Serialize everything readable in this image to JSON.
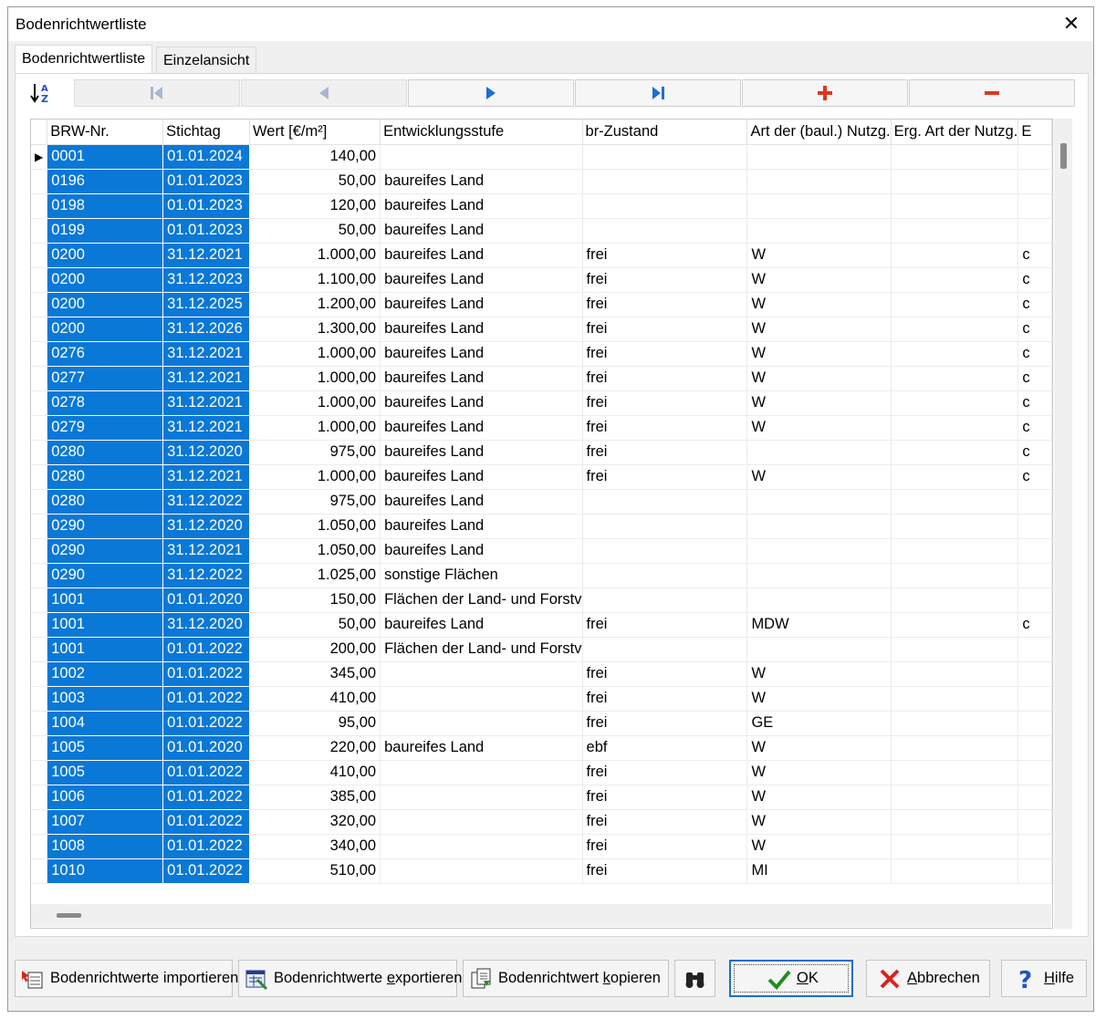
{
  "window": {
    "title": "Bodenrichtwertliste",
    "close_glyph": "✕"
  },
  "tabs": [
    {
      "label": "Bodenrichtwertliste",
      "active": true
    },
    {
      "label": "Einzelansicht",
      "active": false
    }
  ],
  "navigator": {
    "buttons": [
      "first-icon",
      "prior-icon",
      "next-icon",
      "last-icon",
      "plus-icon",
      "minus-icon"
    ],
    "colors": {
      "disabled": "#a9b7cc",
      "active": "#1f6ed4",
      "add": "#e0361c",
      "remove": "#e0361c"
    }
  },
  "grid": {
    "columns": [
      "BRW-Nr.",
      "Stichtag",
      "Wert [€/m²]",
      "Entwicklungsstufe",
      "br-Zustand",
      "Art der (baul.) Nutzg.",
      "Erg. Art der Nutzg.",
      "E"
    ],
    "current_row_marker": "▶",
    "selection_color": "#0a78d7",
    "rows": [
      [
        "0001",
        "01.01.2024",
        "140,00",
        "",
        "",
        "",
        "",
        ""
      ],
      [
        "0196",
        "01.01.2023",
        "50,00",
        "baureifes Land",
        "",
        "",
        "",
        ""
      ],
      [
        "0198",
        "01.01.2023",
        "120,00",
        "baureifes Land",
        "",
        "",
        "",
        ""
      ],
      [
        "0199",
        "01.01.2023",
        "50,00",
        "baureifes Land",
        "",
        "",
        "",
        ""
      ],
      [
        "0200",
        "31.12.2021",
        "1.000,00",
        "baureifes Land",
        "frei",
        "W",
        "",
        "c"
      ],
      [
        "0200",
        "31.12.2023",
        "1.100,00",
        "baureifes Land",
        "frei",
        "W",
        "",
        "c"
      ],
      [
        "0200",
        "31.12.2025",
        "1.200,00",
        "baureifes Land",
        "frei",
        "W",
        "",
        "c"
      ],
      [
        "0200",
        "31.12.2026",
        "1.300,00",
        "baureifes Land",
        "frei",
        "W",
        "",
        "c"
      ],
      [
        "0276",
        "31.12.2021",
        "1.000,00",
        "baureifes Land",
        "frei",
        "W",
        "",
        "c"
      ],
      [
        "0277",
        "31.12.2021",
        "1.000,00",
        "baureifes Land",
        "frei",
        "W",
        "",
        "c"
      ],
      [
        "0278",
        "31.12.2021",
        "1.000,00",
        "baureifes Land",
        "frei",
        "W",
        "",
        "c"
      ],
      [
        "0279",
        "31.12.2021",
        "1.000,00",
        "baureifes Land",
        "frei",
        "W",
        "",
        "c"
      ],
      [
        "0280",
        "31.12.2020",
        "975,00",
        "baureifes Land",
        "frei",
        "",
        "",
        "c"
      ],
      [
        "0280",
        "31.12.2021",
        "1.000,00",
        "baureifes Land",
        "frei",
        "W",
        "",
        "c"
      ],
      [
        "0280",
        "31.12.2022",
        "975,00",
        "baureifes Land",
        "",
        "",
        "",
        ""
      ],
      [
        "0290",
        "31.12.2020",
        "1.050,00",
        "baureifes Land",
        "",
        "",
        "",
        ""
      ],
      [
        "0290",
        "31.12.2021",
        "1.050,00",
        "baureifes Land",
        "",
        "",
        "",
        ""
      ],
      [
        "0290",
        "31.12.2022",
        "1.025,00",
        "sonstige Flächen",
        "",
        "",
        "",
        ""
      ],
      [
        "1001",
        "01.01.2020",
        "150,00",
        "Flächen der Land- und Forstv",
        "",
        "",
        "",
        ""
      ],
      [
        "1001",
        "31.12.2020",
        "50,00",
        "baureifes Land",
        "frei",
        "MDW",
        "",
        "c"
      ],
      [
        "1001",
        "01.01.2022",
        "200,00",
        "Flächen der Land- und Forstv",
        "",
        "",
        "",
        ""
      ],
      [
        "1002",
        "01.01.2022",
        "345,00",
        "",
        "frei",
        "W",
        "",
        ""
      ],
      [
        "1003",
        "01.01.2022",
        "410,00",
        "",
        "frei",
        "W",
        "",
        ""
      ],
      [
        "1004",
        "01.01.2022",
        "95,00",
        "",
        "frei",
        "GE",
        "",
        ""
      ],
      [
        "1005",
        "01.01.2020",
        "220,00",
        "baureifes Land",
        "ebf",
        "W",
        "",
        ""
      ],
      [
        "1005",
        "01.01.2022",
        "410,00",
        "",
        "frei",
        "W",
        "",
        ""
      ],
      [
        "1006",
        "01.01.2022",
        "385,00",
        "",
        "frei",
        "W",
        "",
        ""
      ],
      [
        "1007",
        "01.01.2022",
        "320,00",
        "",
        "frei",
        "W",
        "",
        ""
      ],
      [
        "1008",
        "01.01.2022",
        "340,00",
        "",
        "frei",
        "W",
        "",
        ""
      ],
      [
        "1010",
        "01.01.2022",
        "510,00",
        "",
        "frei",
        "MI",
        "",
        ""
      ]
    ]
  },
  "buttons": {
    "import": {
      "label": "Bodenrichtwerte importieren",
      "icon": "import-icon"
    },
    "export": {
      "pre": "Bodenrichtwerte ",
      "ul": "e",
      "post": "xportieren",
      "icon": "export-icon"
    },
    "copy": {
      "pre": "Bodenrichtwert ",
      "ul": "k",
      "post": "opieren",
      "icon": "copy-icon"
    },
    "search": {
      "icon": "binoculars-icon"
    },
    "ok": {
      "pre": "",
      "ul": "O",
      "post": "K",
      "icon": "check-icon"
    },
    "cancel": {
      "pre": "",
      "ul": "A",
      "post": "bbrechen",
      "icon": "cross-icon"
    },
    "help": {
      "pre": "",
      "ul": "H",
      "post": "ilfe",
      "icon": "help-icon"
    }
  }
}
